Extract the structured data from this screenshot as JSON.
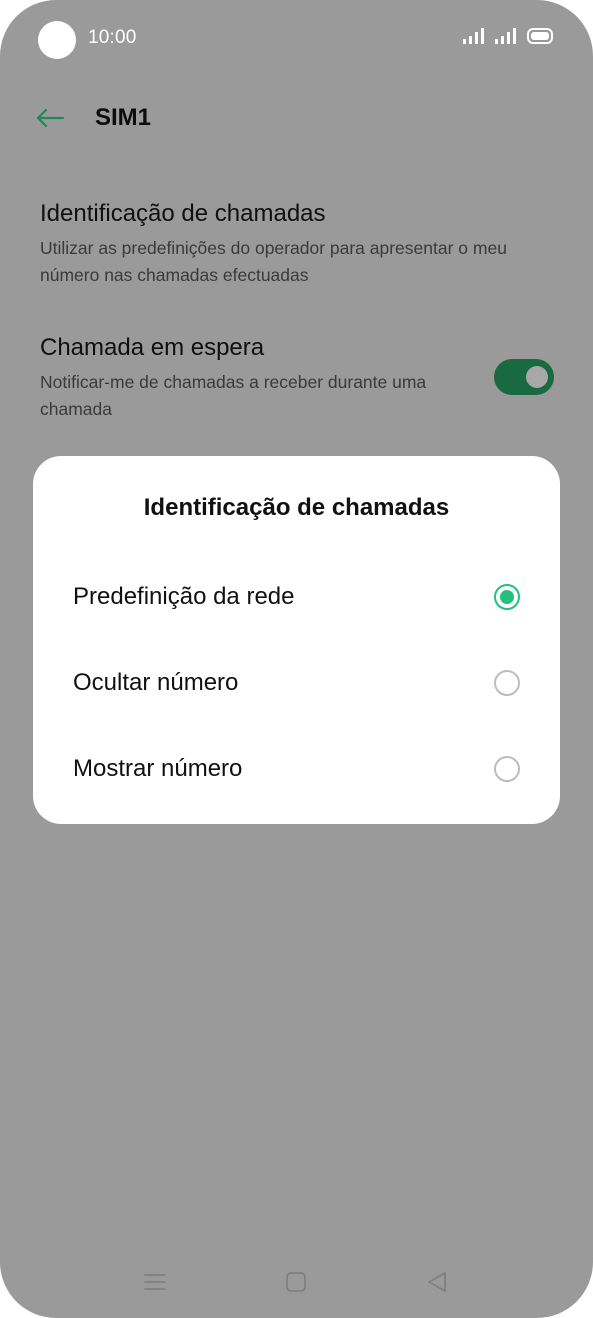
{
  "status_bar": {
    "time": "10:00"
  },
  "header": {
    "title": "SIM1",
    "back_icon": "arrow-left-icon",
    "accent_color": "#1f8a56"
  },
  "settings": [
    {
      "title": "Identificação de chamadas",
      "description": "Utilizar as predefinições do operador para apresentar o meu número nas chamadas efectuadas"
    },
    {
      "title": "Chamada em espera",
      "description": "Notificar-me de chamadas a receber durante uma chamada",
      "toggle_on": true
    }
  ],
  "dialog": {
    "title": "Identificação de chamadas",
    "options": [
      {
        "label": "Predefinição da rede",
        "selected": true
      },
      {
        "label": "Ocultar número",
        "selected": false
      },
      {
        "label": "Mostrar número",
        "selected": false
      }
    ],
    "selected_color": "#22c07c"
  },
  "nav_bar": {
    "icons": [
      "menu-icon",
      "home-square-icon",
      "back-triangle-icon"
    ]
  }
}
